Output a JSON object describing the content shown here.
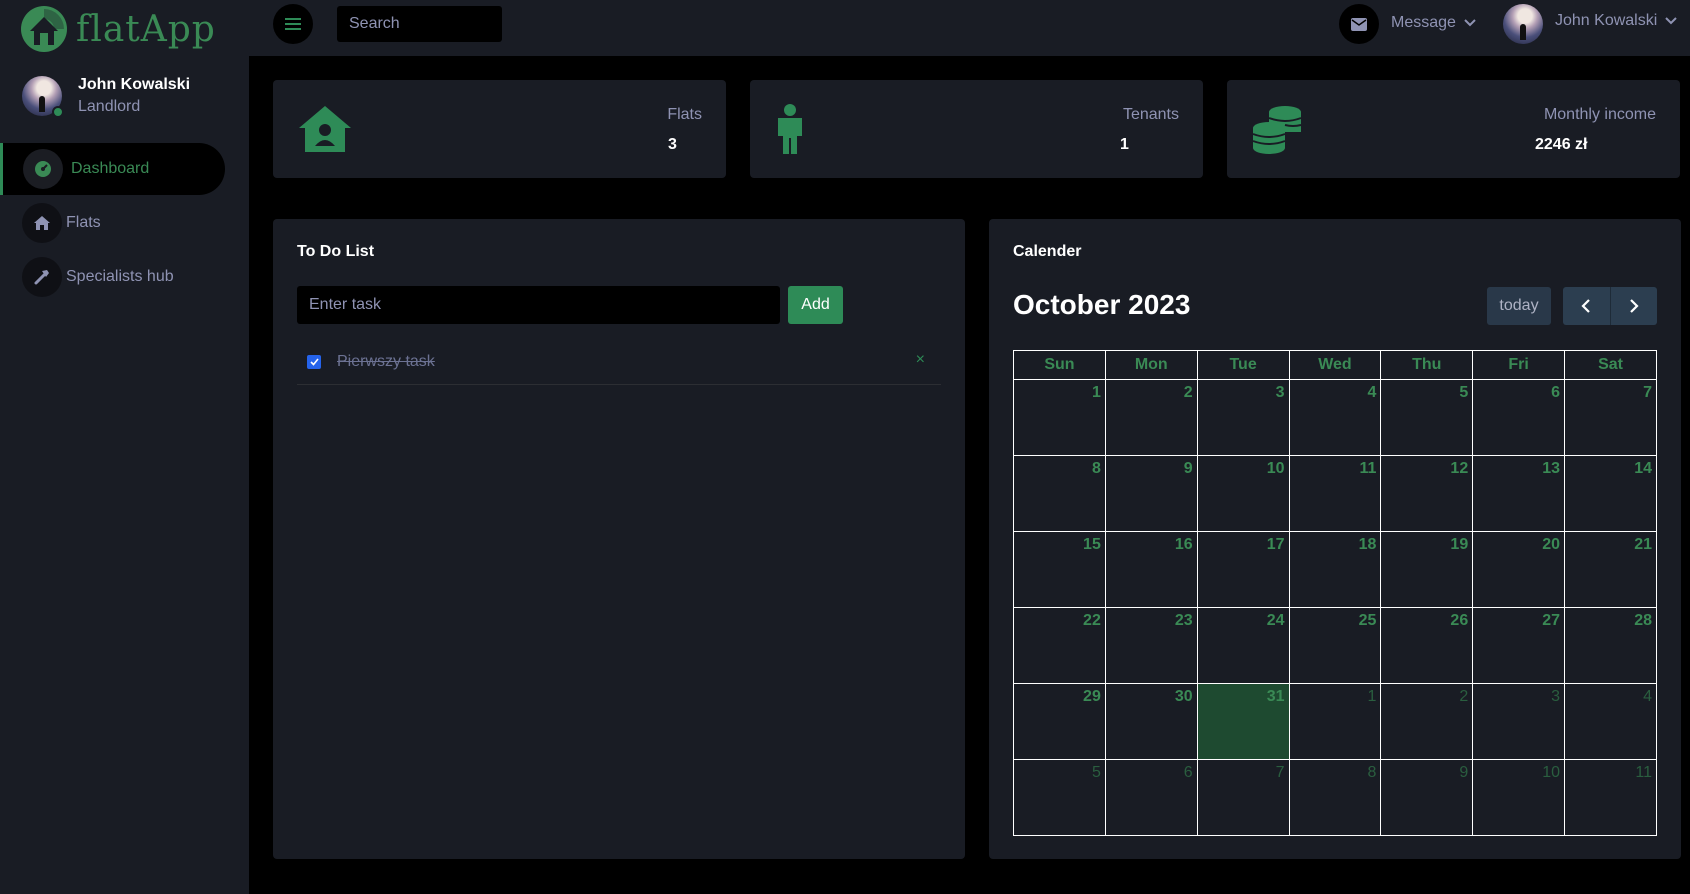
{
  "app": {
    "name": "flatApp"
  },
  "user": {
    "name": "John Kowalski",
    "role": "Landlord"
  },
  "nav": [
    {
      "label": "Dashboard",
      "icon": "speedometer-icon",
      "active": true
    },
    {
      "label": "Flats",
      "icon": "home-icon",
      "active": false
    },
    {
      "label": "Specialists hub",
      "icon": "hammer-icon",
      "active": false
    }
  ],
  "topbar": {
    "search_placeholder": "Search",
    "message_label": "Message",
    "user_name": "John Kowalski"
  },
  "stats": [
    {
      "label": "Flats",
      "value": "3",
      "icon": "house-user-icon"
    },
    {
      "label": "Tenants",
      "value": "1",
      "icon": "person-icon"
    },
    {
      "label": "Monthly income",
      "value": "2246 zł",
      "icon": "coins-icon"
    }
  ],
  "todo": {
    "title": "To Do List",
    "input_placeholder": "Enter task",
    "add_label": "Add",
    "tasks": [
      {
        "text": "Pierwszy task",
        "done": true,
        "remove": "×"
      }
    ]
  },
  "calendar": {
    "title": "Calender",
    "month_label": "October 2023",
    "today_label": "today",
    "weekdays": [
      "Sun",
      "Mon",
      "Tue",
      "Wed",
      "Thu",
      "Fri",
      "Sat"
    ],
    "weeks": [
      [
        "1",
        "2",
        "3",
        "4",
        "5",
        "6",
        "7"
      ],
      [
        "8",
        "9",
        "10",
        "11",
        "12",
        "13",
        "14"
      ],
      [
        "15",
        "16",
        "17",
        "18",
        "19",
        "20",
        "21"
      ],
      [
        "22",
        "23",
        "24",
        "25",
        "26",
        "27",
        "28"
      ],
      [
        "29",
        "30",
        "31",
        "1",
        "2",
        "3",
        "4"
      ],
      [
        "5",
        "6",
        "7",
        "8",
        "9",
        "10",
        "11"
      ]
    ],
    "today_date": "31",
    "colors": {
      "accent": "#2e8b57",
      "today_bg": "#1e4a30"
    }
  }
}
